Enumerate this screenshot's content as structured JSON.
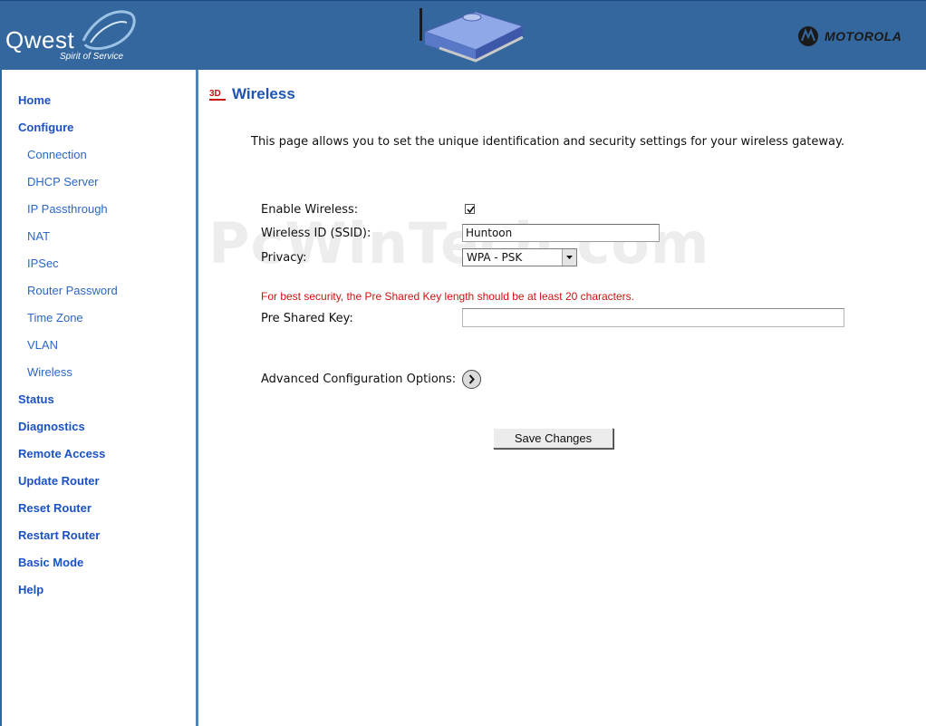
{
  "header": {
    "brand": "Qwest",
    "tagline": "Spirit of Service",
    "partner": "MOTOROLA",
    "colors": {
      "banner": "#34679d"
    }
  },
  "sidebar": {
    "items": [
      {
        "label": "Home",
        "level": 0
      },
      {
        "label": "Configure",
        "level": 0
      },
      {
        "label": "Connection",
        "level": 1
      },
      {
        "label": "DHCP Server",
        "level": 1
      },
      {
        "label": "IP Passthrough",
        "level": 1
      },
      {
        "label": "NAT",
        "level": 1
      },
      {
        "label": "IPSec",
        "level": 1
      },
      {
        "label": "Router Password",
        "level": 1
      },
      {
        "label": "Time Zone",
        "level": 1
      },
      {
        "label": "VLAN",
        "level": 1
      },
      {
        "label": "Wireless",
        "level": 1
      },
      {
        "label": "Status",
        "level": 0
      },
      {
        "label": "Diagnostics",
        "level": 0
      },
      {
        "label": "Remote Access",
        "level": 0
      },
      {
        "label": "Update Router",
        "level": 0
      },
      {
        "label": "Reset Router",
        "level": 0
      },
      {
        "label": "Restart Router",
        "level": 0
      },
      {
        "label": "Basic Mode",
        "level": 0
      },
      {
        "label": "Help",
        "level": 0
      }
    ]
  },
  "main": {
    "page_icon_text": "3D",
    "title": "Wireless",
    "intro": "This page allows you to set the unique identification and security settings for your wireless gateway.",
    "enable_wireless_label": "Enable Wireless:",
    "enable_wireless_checked": true,
    "ssid_label": "Wireless ID (SSID):",
    "ssid_value": "Huntoon",
    "privacy_label": "Privacy:",
    "privacy_value": "WPA - PSK",
    "warning": "For best security, the Pre Shared Key length should be at least 20 characters.",
    "psk_label": "Pre Shared Key:",
    "psk_value": "",
    "advanced_label": "Advanced Configuration Options:",
    "save_label": "Save Changes",
    "watermark": "PcWinTech.com"
  }
}
